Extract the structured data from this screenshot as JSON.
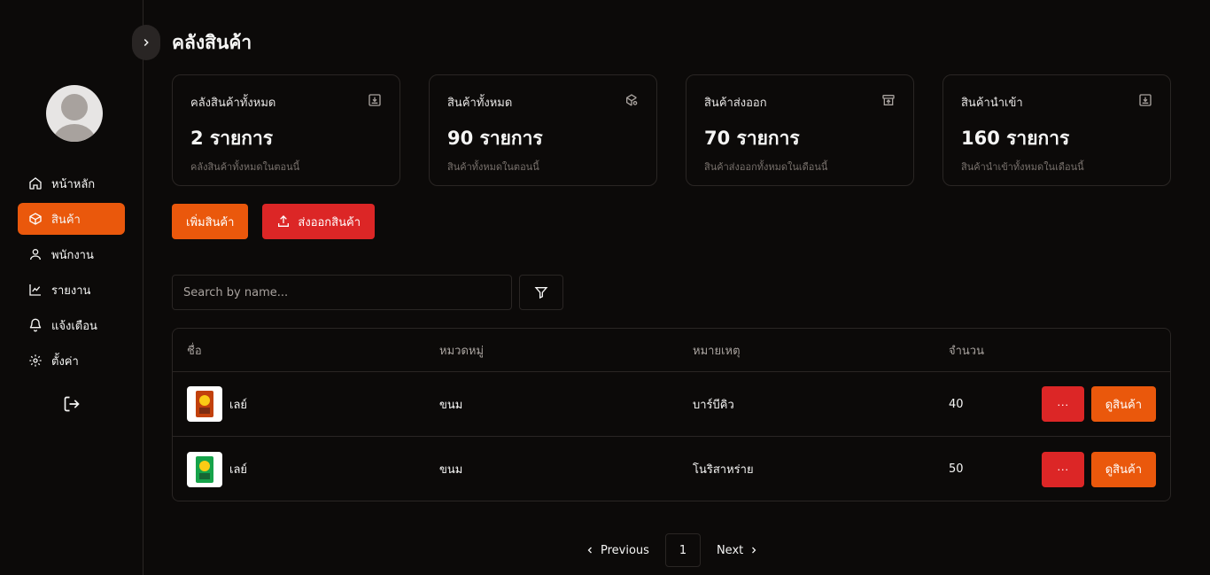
{
  "sidebar": {
    "items": [
      {
        "label": "หน้าหลัก",
        "icon": "home-icon"
      },
      {
        "label": "สินค้า",
        "icon": "box-icon",
        "active": true
      },
      {
        "label": "พนักงาน",
        "icon": "user-icon"
      },
      {
        "label": "รายงาน",
        "icon": "chart-line-icon"
      },
      {
        "label": "แจ้งเตือน",
        "icon": "bell-icon"
      },
      {
        "label": "ตั้งค่า",
        "icon": "gear-icon"
      }
    ]
  },
  "header": {
    "title": "คลังสินค้า"
  },
  "cards": [
    {
      "title": "คลังสินค้าทั้งหมด",
      "value": "2 รายการ",
      "sub": "คลังสินค้าทั้งหมดในตอนนี้",
      "icon": "download-box-icon"
    },
    {
      "title": "สินค้าทั้งหมด",
      "value": "90 รายการ",
      "sub": "สินค้าทั้งหมดในตอนนี้",
      "icon": "package-search-icon"
    },
    {
      "title": "สินค้าส่งออก",
      "value": "70 รายการ",
      "sub": "สินค้าส่งออกทั้งหมดในเดือนนี้",
      "icon": "archive-upload-icon"
    },
    {
      "title": "สินค้านำเข้า",
      "value": "160 รายการ",
      "sub": "สินค้านำเข้าทั้งหมดในเดือนนี้",
      "icon": "download-box-icon"
    }
  ],
  "actions": {
    "add_label": "เพิ่มสินค้า",
    "export_label": "ส่งออกสินค้า"
  },
  "search": {
    "placeholder": "Search by name..."
  },
  "table": {
    "headers": [
      "ชื่อ",
      "หมวดหมู่",
      "หมายเหตุ",
      "จำนวน"
    ],
    "rows": [
      {
        "name": "เลย์",
        "category": "ขนม",
        "note": "บาร์บีคิว",
        "qty": "40",
        "more": "···",
        "view": "ดูสินค้า"
      },
      {
        "name": "เลย์",
        "category": "ขนม",
        "note": "โนริสาหร่าย",
        "qty": "50",
        "more": "···",
        "view": "ดูสินค้า"
      }
    ]
  },
  "pagination": {
    "prev": "Previous",
    "page": "1",
    "next": "Next"
  },
  "colors": {
    "accent": "#ea580c",
    "danger": "#dc2626",
    "background": "#0c0a09"
  }
}
